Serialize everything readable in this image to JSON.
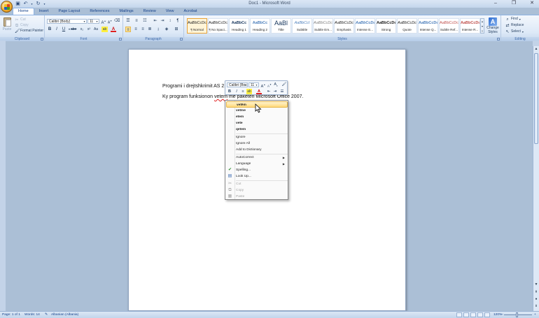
{
  "window": {
    "title": "Doc1 - Microsoft Word",
    "qat_icons": [
      "save-icon",
      "undo-icon",
      "redo-icon",
      "customize-icon"
    ],
    "controls": [
      "minimize-icon",
      "maximize-icon",
      "close-icon"
    ]
  },
  "tabs": [
    {
      "label": "Home",
      "active": true
    },
    {
      "label": "Insert"
    },
    {
      "label": "Page Layout"
    },
    {
      "label": "References"
    },
    {
      "label": "Mailings"
    },
    {
      "label": "Review"
    },
    {
      "label": "View"
    },
    {
      "label": "Acrobat"
    }
  ],
  "ribbon": {
    "clipboard": {
      "label": "Clipboard",
      "paste": "Paste",
      "cut": "Cut",
      "copy": "Copy",
      "format_painter": "Format Painter"
    },
    "font": {
      "label": "Font",
      "font_name": "Calibri (Body)",
      "font_size": "11",
      "bold": "B",
      "italic": "I",
      "underline": "U",
      "strike": "abe",
      "subscript": "x₂",
      "superscript": "x²",
      "change_case": "Aa",
      "grow": "A",
      "shrink": "A"
    },
    "paragraph": {
      "label": "Paragraph",
      "pilcrow": "¶"
    },
    "styles": {
      "label": "Styles",
      "items": [
        {
          "sample": "AaBbCcDc",
          "name": "¶ Normal",
          "active": true
        },
        {
          "sample": "AaBbCcDc",
          "name": "¶ No Spaci..."
        },
        {
          "sample": "AaBbCc",
          "name": "Heading 1"
        },
        {
          "sample": "AaBbCc",
          "name": "Heading 2"
        },
        {
          "sample": "AaBl",
          "name": "Title"
        },
        {
          "sample": "AaBbCcI",
          "name": "Subtitle"
        },
        {
          "sample": "AaBbCcDc",
          "name": "Subtle Em..."
        },
        {
          "sample": "AaBbCcDc",
          "name": "Emphasis"
        },
        {
          "sample": "AaBbCcDc",
          "name": "Intense E..."
        },
        {
          "sample": "AaBbCcDc",
          "name": "Strong"
        },
        {
          "sample": "AaBbCcDc",
          "name": "Quote"
        },
        {
          "sample": "AaBbCcDc",
          "name": "Intense Q..."
        },
        {
          "sample": "AaBbCcDc",
          "name": "Subtle Ref..."
        },
        {
          "sample": "AaBbCcDc",
          "name": "Intense R..."
        }
      ],
      "change_styles": "Change Styles"
    },
    "editing": {
      "label": "Editing",
      "find": "Find",
      "replace": "Replace",
      "select": "Select"
    }
  },
  "document": {
    "line1": "Programi i drejtshkrimit AS 2.0",
    "line2_before": "Ky program funksionon ",
    "line2_misspelled": "vetem",
    "line2_after": " me paketen Microsoft Office 2007."
  },
  "mini_toolbar": {
    "font_name": "Calibri (Boc",
    "font_size": "11"
  },
  "context_menu": {
    "suggestions": [
      "vetëm",
      "vetme",
      "etem",
      "vete",
      "qetem"
    ],
    "ignore": "Ignore",
    "ignore_all": "Ignore All",
    "add_to_dictionary": "Add to Dictionary",
    "autocorrect": "AutoCorrect",
    "language": "Language",
    "spelling": "Spelling...",
    "look_up": "Look Up...",
    "cut": "Cut",
    "copy": "Copy",
    "paste": "Paste"
  },
  "status": {
    "page": "Page: 1 of 1",
    "words": "Words: 14",
    "language": "Albanian (Albania)",
    "zoom": "120%"
  }
}
